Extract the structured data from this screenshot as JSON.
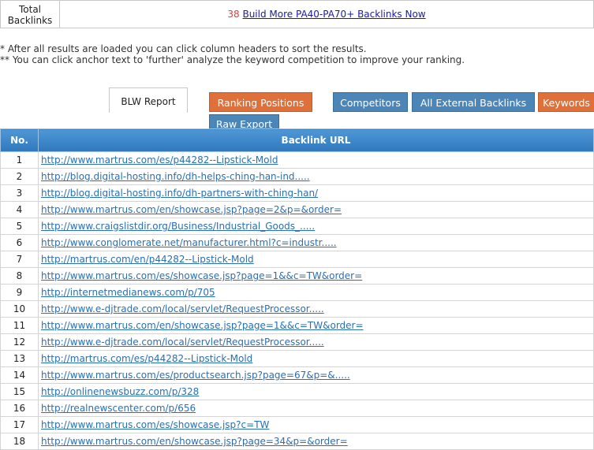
{
  "summary": {
    "label_line1": "Total",
    "label_line2": "Backlinks",
    "count": "38",
    "link_text": "Build More PA40-PA70+ Backlinks Now"
  },
  "notes": {
    "line1": "* After all results are loaded you can click column headers to sort the results.",
    "line2": "** You can click anchor text to 'further' analyze the keyword competition to improve your ranking."
  },
  "tabs": {
    "blw_report": "BLW Report",
    "ranking_positions": "Ranking Positions",
    "competitors": "Competitors",
    "all_external": "All External Backlinks",
    "keywords": "Keywords",
    "raw_export": "Raw Export"
  },
  "colors": {
    "orange": "#e0703a",
    "blue": "#4c86b8",
    "header": "#3a84c8",
    "link": "#2a6fb5"
  },
  "table": {
    "headers": [
      "No.",
      "Backlink URL"
    ],
    "rows": [
      {
        "no": "1",
        "url": "http://www.martrus.com/es/p44282--Lipstick-Mold"
      },
      {
        "no": "2",
        "url": "http://blog.digital-hosting.info/dh-helps-ching-han-ind....."
      },
      {
        "no": "3",
        "url": "http://blog.digital-hosting.info/dh-partners-with-ching-han/"
      },
      {
        "no": "4",
        "url": "http://www.martrus.com/en/showcase.jsp?page=2&p=&order="
      },
      {
        "no": "5",
        "url": "http://www.craigslistdir.org/Business/Industrial_Goods_....."
      },
      {
        "no": "6",
        "url": "http://www.conglomerate.net/manufacturer.html?c=industr....."
      },
      {
        "no": "7",
        "url": "http://martrus.com/en/p44282--Lipstick-Mold"
      },
      {
        "no": "8",
        "url": "http://www.martrus.com/es/showcase.jsp?page=1&&c=TW&order="
      },
      {
        "no": "9",
        "url": "http://internetmedianews.com/p/705"
      },
      {
        "no": "10",
        "url": "http://www.e-djtrade.com/local/servlet/RequestProcessor....."
      },
      {
        "no": "11",
        "url": "http://www.martrus.com/en/showcase.jsp?page=1&&c=TW&order="
      },
      {
        "no": "12",
        "url": "http://www.e-djtrade.com/local/servlet/RequestProcessor....."
      },
      {
        "no": "13",
        "url": "http://martrus.com/es/p44282--Lipstick-Mold"
      },
      {
        "no": "14",
        "url": "http://www.martrus.com/es/productsearch.jsp?page=67&p=&....."
      },
      {
        "no": "15",
        "url": "http://onlinenewsbuzz.com/p/328"
      },
      {
        "no": "16",
        "url": "http://realnewscenter.com/p/656"
      },
      {
        "no": "17",
        "url": "http://www.martrus.com/es/showcase.jsp?c=TW"
      },
      {
        "no": "18",
        "url": "http://www.martrus.com/en/showcase.jsp?page=34&p=&order="
      }
    ]
  }
}
